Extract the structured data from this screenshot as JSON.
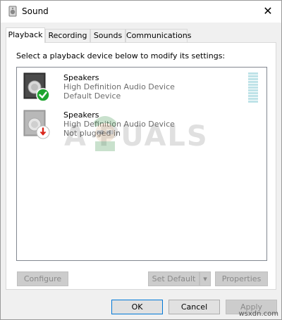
{
  "window": {
    "title": "Sound"
  },
  "tabs": [
    {
      "label": "Playback",
      "active": true
    },
    {
      "label": "Recording",
      "active": false
    },
    {
      "label": "Sounds",
      "active": false
    },
    {
      "label": "Communications",
      "active": false
    }
  ],
  "playback": {
    "instruction": "Select a playback device below to modify its settings:",
    "devices": [
      {
        "name": "Speakers",
        "description": "High Definition Audio Device",
        "status": "Default Device",
        "badge": "check-icon",
        "badge_color": "#1ea530"
      },
      {
        "name": "Speakers",
        "description": "High Definition Audio Device",
        "status": "Not plugged in",
        "badge": "down-arrow-icon",
        "badge_color": "#d9261c"
      }
    ]
  },
  "buttons": {
    "configure": "Configure",
    "set_default": "Set Default",
    "properties": "Properties",
    "ok": "OK",
    "cancel": "Cancel",
    "apply": "Apply"
  },
  "watermark": "A PUALS",
  "site": "wsxdn.com"
}
